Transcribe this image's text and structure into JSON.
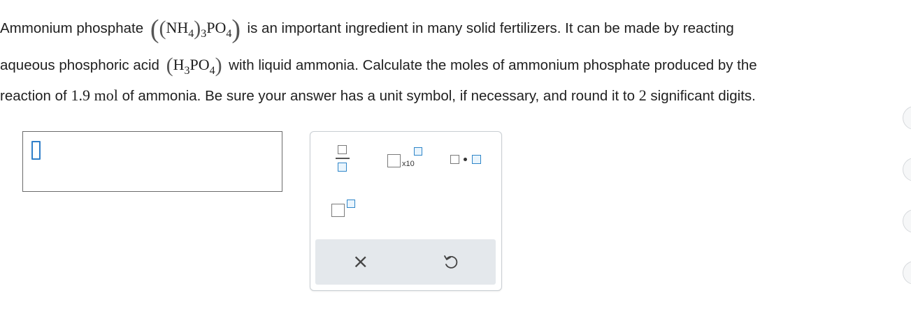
{
  "question": {
    "line1_pre": "Ammonium phosphate",
    "line1_post": "is an important ingredient in many solid fertilizers. It can be made by reacting",
    "line2_pre": "aqueous phosphoric acid",
    "line2_post": "with liquid ammonia. Calculate the moles of ammonium phosphate produced by the",
    "line3_pre": "reaction of",
    "amount_value": "1.9",
    "amount_unit": "mol",
    "line3_mid": "of ammonia. Be sure your answer has a unit symbol, if necessary, and round it to",
    "sig_digits": "2",
    "line3_post": "significant digits.",
    "formula_ammonium_phosphate": {
      "nh": "NH",
      "n4": "4",
      "n3": "3",
      "po": "PO",
      "o4": "4"
    },
    "formula_phosphoric_acid": {
      "h": "H",
      "h3": "3",
      "po": "PO",
      "o4": "4"
    }
  },
  "answer": {
    "value": ""
  },
  "palette": {
    "x10_label": "x10",
    "clear_symbol": "×",
    "undo_icon": "undo-icon"
  },
  "colors": {
    "accent": "#2f86c9",
    "palette_bar": "#e4e8ec"
  }
}
